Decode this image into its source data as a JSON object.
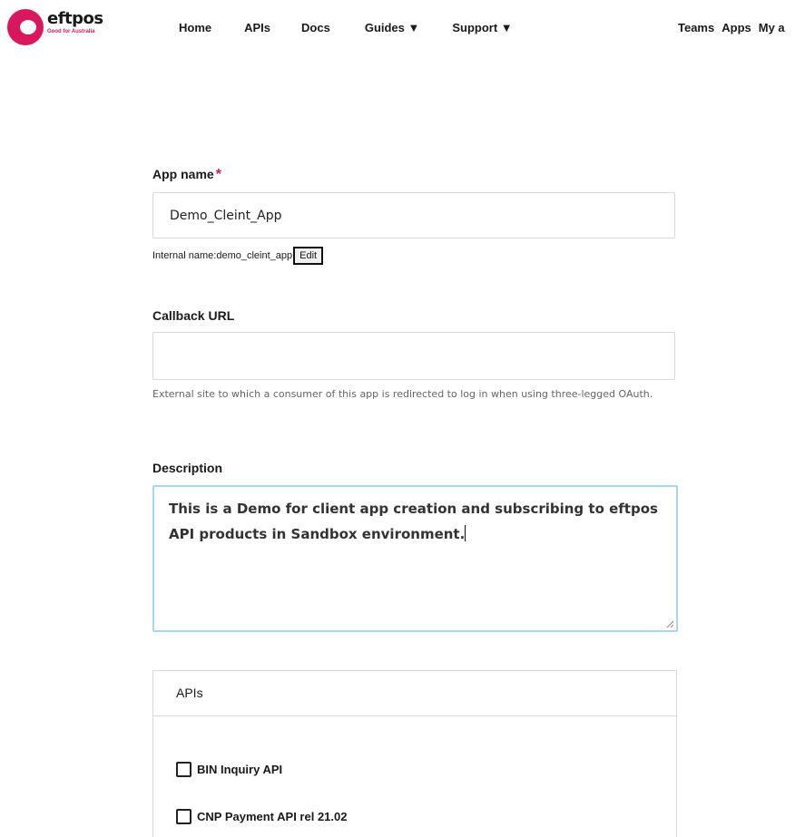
{
  "brand": {
    "name": "eftpos",
    "tagline": "Good for Australia",
    "color": "#d9175f"
  },
  "nav": {
    "items": [
      "Home",
      "APIs",
      "Docs",
      "Guides ▼",
      "Support ▼"
    ],
    "right_items": [
      "Teams",
      "Apps",
      "My a"
    ]
  },
  "form": {
    "app_name": {
      "label": "App name",
      "required_mark": "*",
      "value": "Demo_Cleint_App",
      "internal_prefix": "Internal name: ",
      "internal_value": "demo_cleint_app",
      "edit_label": "Edit"
    },
    "callback": {
      "label": "Callback URL",
      "value": "",
      "help": "External site to which a consumer of this app is redirected to log in when using three-legged OAuth."
    },
    "description": {
      "label": "Description",
      "value": "This is a Demo for client app creation and subscribing to eftpos API products in Sandbox environment."
    },
    "apis": {
      "heading": "APIs",
      "items": [
        {
          "label": "BIN Inquiry API",
          "checked": false
        },
        {
          "label": "CNP Payment API rel 21.02",
          "checked": false
        }
      ]
    }
  },
  "colors": {
    "focus_border": "#a8d4f5",
    "field_border": "#d9d9d9"
  }
}
